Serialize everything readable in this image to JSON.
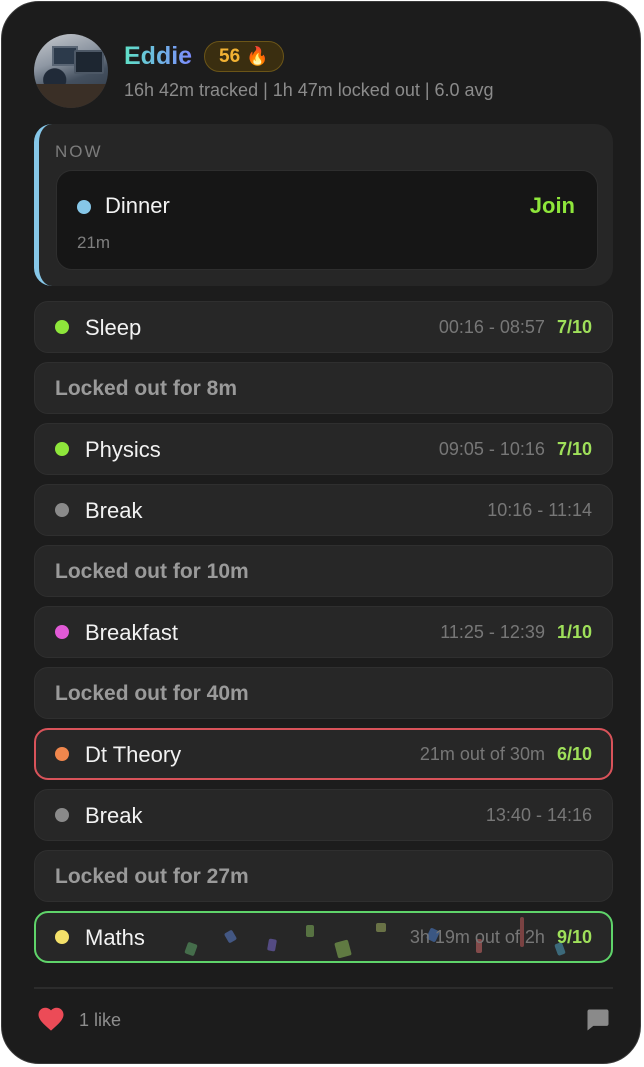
{
  "profile": {
    "name": "Eddie",
    "streak": "56",
    "streak_icon": "fire-icon",
    "stats": "16h 42m tracked | 1h 47m locked out | 6.0 avg"
  },
  "now": {
    "label": "NOW",
    "title": "Dinner",
    "duration": "21m",
    "dot_color": "#86c7e8",
    "join_label": "Join"
  },
  "timeline": [
    {
      "type": "activity",
      "title": "Sleep",
      "time": "00:16 - 08:57",
      "score": "7/10",
      "dot_color": "#8ee63b"
    },
    {
      "type": "locked",
      "title": "Locked out for 8m"
    },
    {
      "type": "activity",
      "title": "Physics",
      "time": "09:05 - 10:16",
      "score": "7/10",
      "dot_color": "#8ee63b"
    },
    {
      "type": "activity",
      "title": "Break",
      "time": "10:16 - 11:14",
      "score": "",
      "dot_color": "#8a8a8a"
    },
    {
      "type": "locked",
      "title": "Locked out for 10m"
    },
    {
      "type": "activity",
      "title": "Breakfast",
      "time": "11:25 - 12:39",
      "score": "1/10",
      "dot_color": "#e15ad6"
    },
    {
      "type": "locked",
      "title": "Locked out for 40m"
    },
    {
      "type": "activity",
      "title": "Dt Theory",
      "time": "21m out of 30m",
      "score": "6/10",
      "dot_color": "#f0874d",
      "outline": "#d9535a"
    },
    {
      "type": "activity",
      "title": "Break",
      "time": "13:40 - 14:16",
      "score": "",
      "dot_color": "#8a8a8a"
    },
    {
      "type": "locked",
      "title": "Locked out for 27m"
    },
    {
      "type": "activity",
      "title": "Maths",
      "time": "3h 19m out of 2h",
      "score": "9/10",
      "dot_color": "#f4e16a",
      "outline": "#5fd46a"
    }
  ],
  "footer": {
    "likes": "1 like",
    "like_icon": "heart-icon",
    "comment_icon": "comment-icon"
  }
}
